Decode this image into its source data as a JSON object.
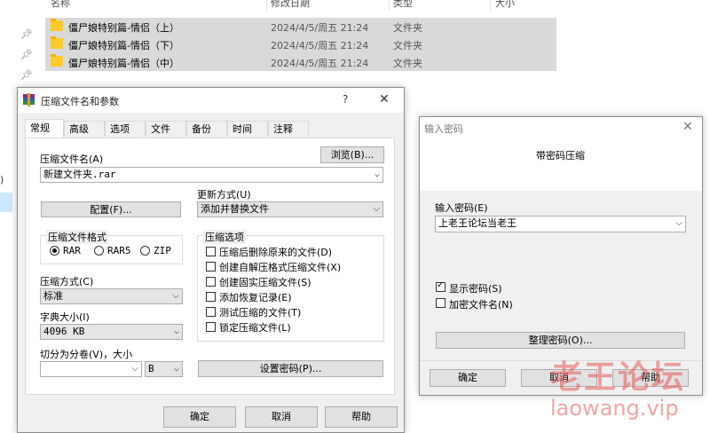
{
  "explorer": {
    "columns": {
      "name": "名称",
      "date": "修改日期",
      "type": "类型",
      "size": "大小"
    },
    "files": [
      {
        "name": "僵尸娘特别篇-情侣（上）",
        "date": "2024/4/5/周五 21:24",
        "type": "文件夹"
      },
      {
        "name": "僵尸娘特别篇-情侣（下）",
        "date": "2024/4/5/周五 21:24",
        "type": "文件夹"
      },
      {
        "name": "僵尸娘特别篇-情侣（中）",
        "date": "2024/4/5/周五 21:24",
        "type": "文件夹"
      }
    ],
    "pin_icon": "pin-icon",
    "left_fragment": ")"
  },
  "archive_dialog": {
    "title": "压缩文件名和参数",
    "help_glyph": "?",
    "close_glyph": "✕",
    "tabs": [
      "常规",
      "高级",
      "选项",
      "文件",
      "备份",
      "时间",
      "注释"
    ],
    "archive_name_label": "压缩文件名(A)",
    "browse_button": "浏览(B)...",
    "archive_name_value": "新建文件夹.rar",
    "update_mode_label": "更新方式(U)",
    "update_mode_value": "添加并替换文件",
    "profiles_button": "配置(F)...",
    "format_group": "压缩文件格式",
    "formats": [
      "RAR",
      "RAR5",
      "ZIP"
    ],
    "selected_format": "RAR",
    "options_group": "压缩选项",
    "options": [
      "压缩后删除原来的文件(D)",
      "创建自解压格式压缩文件(X)",
      "创建固实压缩文件(S)",
      "添加恢复记录(E)",
      "测试压缩的文件(T)",
      "锁定压缩文件(L)"
    ],
    "method_label": "压缩方式(C)",
    "method_value": "标准",
    "dict_label": "字典大小(I)",
    "dict_value": "4096 KB",
    "split_label": "切分为分卷(V)，大小",
    "split_unit": "B",
    "set_password_button": "设置密码(P)...",
    "ok_button": "确定",
    "cancel_button": "取消",
    "help_button": "帮助"
  },
  "password_dialog": {
    "title": "输入密码",
    "close_glyph": "✕",
    "heading": "带密码压缩",
    "password_label": "输入密码(E)",
    "password_value": "上老王论坛当老王",
    "show_password_label": "显示密码(S)",
    "show_password_checked": true,
    "encrypt_names_label": "加密文件名(N)",
    "encrypt_names_checked": false,
    "organize_button": "整理密码(O)...",
    "ok_button": "确定",
    "cancel_button": "取消",
    "help_button": "帮助"
  },
  "watermark": {
    "line1": "老王论坛",
    "line2": "laowang.vip"
  },
  "colors": {
    "selection": "#cce8ff",
    "accent": "#0078d7",
    "dialog_bg": "#f0f0f0",
    "folder": "#ffca28",
    "watermark": "#e85a5a"
  }
}
